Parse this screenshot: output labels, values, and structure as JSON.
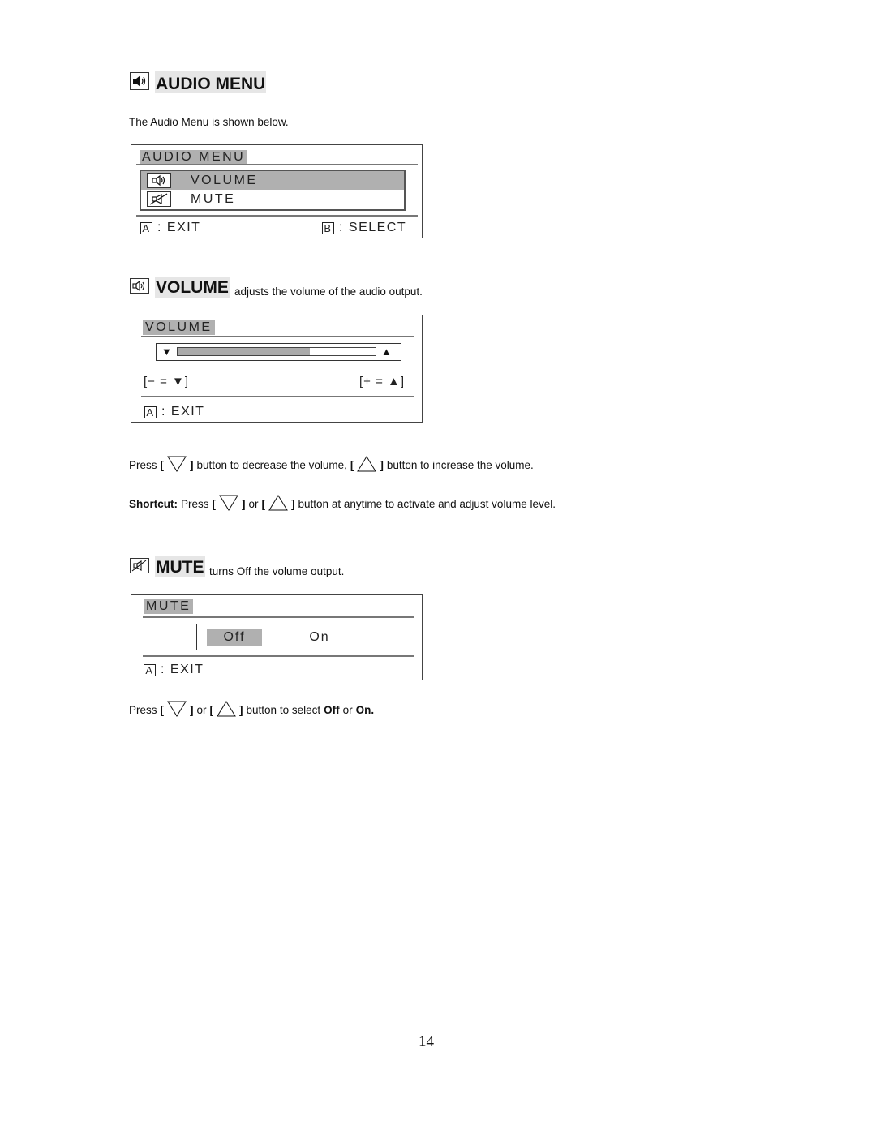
{
  "audio_menu_section": {
    "icon": "speaker-icon",
    "title": "AUDIO MENU",
    "intro": "The Audio Menu is shown below.",
    "osd": {
      "title": "AUDIO MENU",
      "items": [
        {
          "icon": "speaker-volume-icon",
          "label": "VOLUME",
          "selected": true
        },
        {
          "icon": "speaker-mute-icon",
          "label": "MUTE",
          "selected": false
        }
      ],
      "exit_key": "A",
      "exit_label": ": EXIT",
      "select_key": "B",
      "select_label": ": SELECT"
    }
  },
  "volume_section": {
    "icon": "speaker-volume-icon",
    "title": "VOLUME",
    "description": "adjusts the volume of the audio output.",
    "osd": {
      "title": "VOLUME",
      "level_percent": 67,
      "minus_hint": "− = ▼",
      "plus_hint": "+ = ▲",
      "exit_key": "A",
      "exit_label": ": EXIT"
    },
    "instruction": {
      "press": "Press",
      "open_bracket": "[",
      "close_bracket": "]",
      "decrease_text": "button to decrease the volume,",
      "increase_text": "button to increase the volume."
    },
    "shortcut": {
      "label": "Shortcut:",
      "press": "Press",
      "open_bracket": "[",
      "close_bracket": "]",
      "or": "or",
      "text": "button at anytime to activate and adjust volume level."
    }
  },
  "mute_section": {
    "icon": "speaker-mute-icon",
    "title": "MUTE",
    "description": "turns Off the volume output.",
    "osd": {
      "title": "MUTE",
      "options": [
        "Off",
        "On"
      ],
      "selected": "Off",
      "exit_key": "A",
      "exit_label": ": EXIT"
    },
    "instruction": {
      "press": "Press",
      "open_bracket": "[",
      "close_bracket": "]",
      "or": "or",
      "text": "button to select",
      "off": "Off",
      "or2": "or",
      "on": "On."
    }
  },
  "page_number": "14"
}
